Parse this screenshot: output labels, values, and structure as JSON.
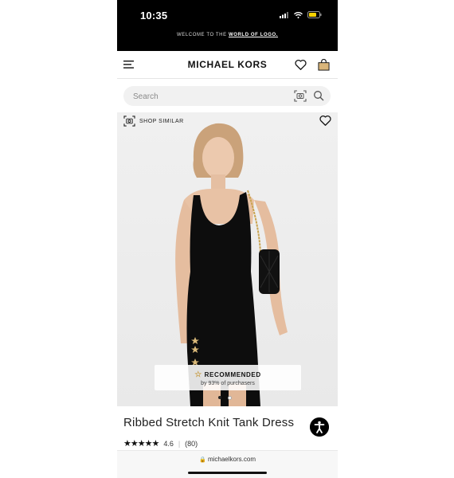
{
  "status": {
    "time": "10:35"
  },
  "promo": {
    "prefix": "WELCOME TO THE ",
    "link": "WORLD OF LOGO."
  },
  "header": {
    "brand": "MICHAEL KORS"
  },
  "search": {
    "placeholder": "Search"
  },
  "product": {
    "shop_similar": "SHOP SIMILAR",
    "recommended_title": "RECOMMENDED",
    "recommended_sub": "by 93% of purchasers",
    "title": "Ribbed Stretch Knit Tank Dress",
    "stars": "★★★★★",
    "rating": "4.6",
    "reviews": "(80)"
  },
  "browser": {
    "url": "michaelkors.com"
  },
  "colors": {
    "status_bg": "#000000",
    "battery": "#f5d100",
    "dress": "#0d0d0d"
  }
}
